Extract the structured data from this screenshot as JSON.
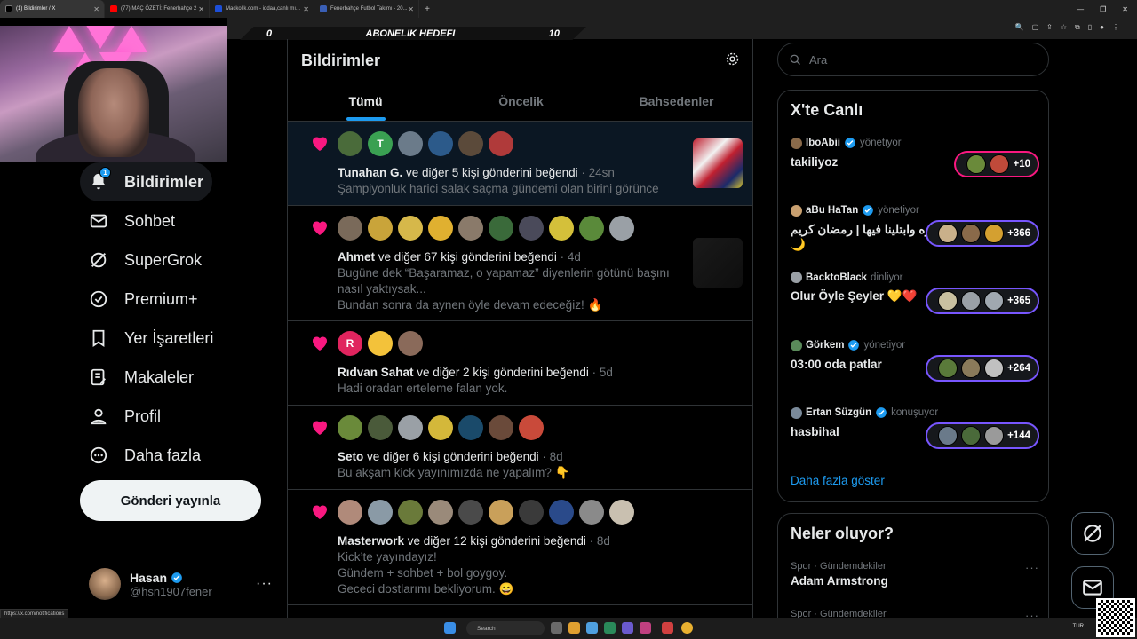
{
  "browser": {
    "tabs": [
      {
        "title": "(1) Bildirimler / X",
        "active": true,
        "fav_color": "#000000"
      },
      {
        "title": "(77) MAÇ ÖZETİ: Fenerbahçe 2",
        "active": false,
        "fav_color": "#ff0000"
      },
      {
        "title": "Mackolik.com - iddaa,canlı mı...",
        "active": false,
        "fav_color": "#1d4fd8"
      },
      {
        "title": "Fenerbahçe Futbol Takımı - 20...",
        "active": false,
        "fav_color": "#3a5fb5"
      }
    ],
    "new_tab": "+",
    "status_url": "https://x.com/notifications"
  },
  "stream_overlay": {
    "left": "0",
    "label": "ABONELIK HEDEFI",
    "right": "10"
  },
  "sidebar": {
    "items": [
      {
        "label": "Bildirimler",
        "icon": "bell-icon",
        "badge": "1",
        "active": true
      },
      {
        "label": "Sohbet",
        "icon": "mail-icon"
      },
      {
        "label": "SuperGrok",
        "icon": "grok-icon"
      },
      {
        "label": "Premium+",
        "icon": "premium-icon"
      },
      {
        "label": "Yer İşaretleri",
        "icon": "bookmark-icon"
      },
      {
        "label": "Makaleler",
        "icon": "article-icon"
      },
      {
        "label": "Profil",
        "icon": "person-icon"
      },
      {
        "label": "Daha fazla",
        "icon": "more-circle-icon"
      }
    ],
    "post_button": "Gönderi yayınla",
    "profile": {
      "name": "Hasan",
      "handle": "@hsn1907fener",
      "more": "···"
    }
  },
  "main": {
    "title": "Bildirimler",
    "tabs": [
      "Tümü",
      "Öncelik",
      "Bahsedenler"
    ],
    "notifications": [
      {
        "who": "Tunahan G.",
        "rest": " ve diğer 5 kişi gönderini beğendi",
        "time": " · 24sn",
        "body": [
          "Şampiyonluk harici salak saçma gündemi olan birini görünce"
        ],
        "avatars": [
          "#4a6b3a",
          "#3aa052",
          "#6b7b8a",
          "#2c5a8a",
          "#5b4a3a",
          "#b03a3a"
        ],
        "letters": [
          "",
          "T",
          "",
          "",
          "",
          ""
        ]
      },
      {
        "who": "Ahmet",
        "rest": " ve diğer 67 kişi gönderini beğendi",
        "time": " · 4d",
        "body": [
          "Bugüne dek “Başaramaz, o yapamaz” diyenlerin götünü başını",
          "nasıl yaktıysak...",
          "Bundan sonra da aynen öyle devam edeceğiz! 🔥"
        ],
        "avatars": [
          "#7a6a5a",
          "#c9a43a",
          "#d6b84a",
          "#e0b030",
          "#8a7a6a",
          "#3a6a3a",
          "#4a4a5a",
          "#d4c03a",
          "#5a8a3a",
          "#9aa0a6"
        ],
        "letters": [
          "",
          "",
          "",
          "",
          "",
          "",
          "",
          "",
          "",
          ""
        ]
      },
      {
        "who": "Rıdvan Sahat",
        "rest": " ve diğer 2 kişi gönderini beğendi",
        "time": " · 5d",
        "body": [
          "Hadi oradan erteleme falan yok."
        ],
        "avatars": [
          "#e0245e",
          "#f3c23a",
          "#8a6a5a"
        ],
        "letters": [
          "R",
          "",
          ""
        ]
      },
      {
        "who": "Seto",
        "rest": " ve diğer 6 kişi gönderini beğendi",
        "time": " · 8d",
        "body": [
          "Bu akşam kick yayınımızda ne yapalım? 👇"
        ],
        "avatars": [
          "#6a8a3a",
          "#4a5a3a",
          "#9aa0a6",
          "#d4b83a",
          "#1a4a6a",
          "#6a4a3a",
          "#c94a3a"
        ],
        "letters": [
          "",
          "",
          "",
          "",
          "",
          "",
          ""
        ]
      },
      {
        "who": "Masterwork",
        "rest": " ve diğer 12 kişi gönderini beğendi",
        "time": " · 8d",
        "body": [
          "Kick’te yayındayız!",
          "Gündem + sohbet + bol goygoy.",
          "Gececi dostlarımı bekliyorum. 😄"
        ],
        "avatars": [
          "#b08a7a",
          "#8a9aa6",
          "#6a7a3a",
          "#9a8a7a",
          "#4a4a4a",
          "#c9a05a",
          "#3a3a3a",
          "#2a4a8a",
          "#8a8a8a",
          "#c9c0b0"
        ],
        "letters": [
          "",
          "",
          "",
          "",
          "",
          "",
          "",
          "",
          "",
          ""
        ]
      }
    ]
  },
  "right": {
    "search_placeholder": "Ara",
    "live_title": "X'te Canlı",
    "live": [
      {
        "name": "IboAbii",
        "verified": true,
        "action": "yönetiyor",
        "title": "takiliyoz",
        "count": "+10",
        "pill": "red"
      },
      {
        "name": "aBu HaTan",
        "verified": true,
        "action": "yönetiyor",
        "title": "بلوه وابتلينا فيها | رمضان كريم 🌙",
        "count": "+366",
        "pill": "purple"
      },
      {
        "name": "BacktoBlack",
        "verified": false,
        "action": "dinliyor",
        "title": "Olur Öyle Şeyler 💛❤️",
        "count": "+365",
        "pill": "purple"
      },
      {
        "name": "Görkem",
        "verified": true,
        "action": "yönetiyor",
        "title": "03:00 oda patlar",
        "count": "+264",
        "pill": "purple"
      },
      {
        "name": "Ertan Süzgün",
        "verified": true,
        "action": "konuşuyor",
        "title": "hasbihal",
        "count": "+144",
        "pill": "purple"
      }
    ],
    "show_more": "Daha fazla göster",
    "trends_title": "Neler oluyor?",
    "trends": [
      {
        "category": "Spor · Gündemdekiler",
        "name": "Adam Armstrong",
        "more": "···"
      },
      {
        "category": "Spor · Gündemdekiler",
        "name": "",
        "more": "···"
      }
    ]
  },
  "taskbar": {
    "search": "Search",
    "lang": "TUR"
  }
}
